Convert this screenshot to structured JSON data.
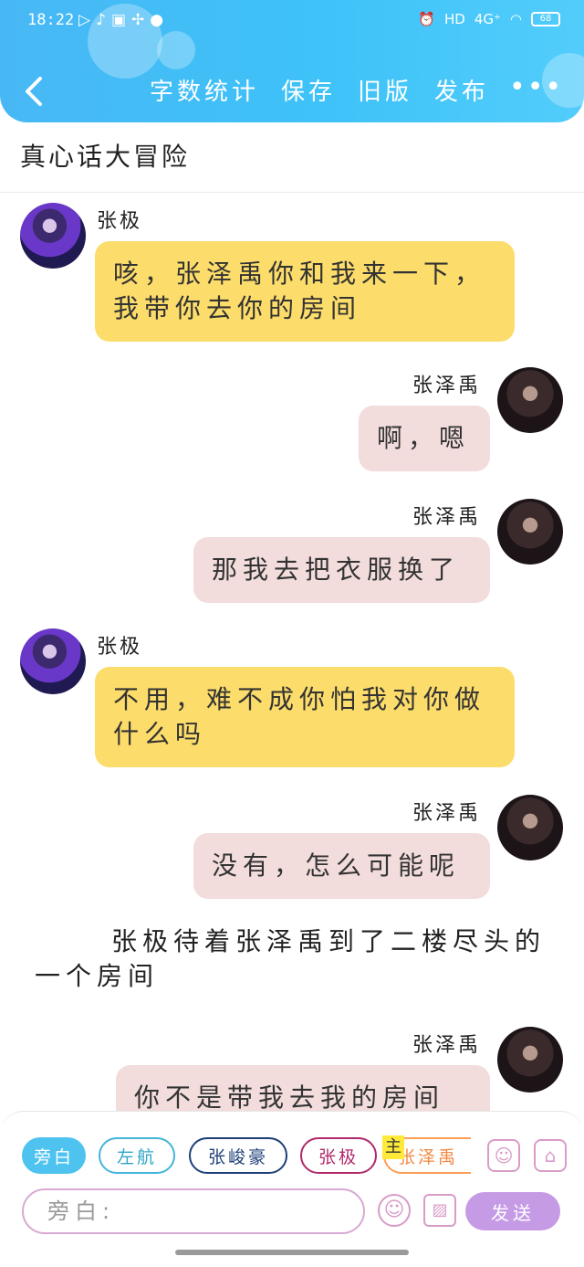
{
  "status_bar": {
    "time": "18:22",
    "network": "4G⁺",
    "hd": "HD",
    "battery": "68",
    "app_icons": [
      "play-icon",
      "tiktok-icon",
      "iqiyi-icon",
      "fan-icon",
      "qq-icon"
    ]
  },
  "toolbar": {
    "back_icon": "chevron-left-icon",
    "word_count": "字数统计",
    "save": "保存",
    "old_version": "旧版",
    "publish": "发布",
    "more": "•••"
  },
  "story_title": "真心话大冒险",
  "messages": [
    {
      "speaker": "张极",
      "side": "left",
      "text": "咳，张泽禹你和我来一下，我带你去你的房间"
    },
    {
      "speaker": "张泽禹",
      "side": "right",
      "text": "啊，嗯"
    },
    {
      "speaker": "张泽禹",
      "side": "right",
      "text": "那我去把衣服换了"
    },
    {
      "speaker": "张极",
      "side": "left",
      "text": "不用，难不成你怕我对你做什么吗"
    },
    {
      "speaker": "张泽禹",
      "side": "right",
      "text": "没有，怎么可能呢"
    },
    {
      "speaker": "张泽禹",
      "side": "right",
      "text": "你不是带我去我的房间"
    }
  ],
  "narration": "张极待着张泽禹到了二楼尽头的一个房间",
  "roles": {
    "narration": "旁白",
    "zuohang": "左航",
    "junhao": "张峻豪",
    "zhangji": "张极",
    "main_tag": "主",
    "zeyu": "张泽禹"
  },
  "input": {
    "placeholder": "旁白:"
  },
  "send_label": "发送",
  "colors": {
    "header": "#48b8f5",
    "left_bubble": "#fcdc6a",
    "right_bubble": "#f2dcdc",
    "send": "#c69be6"
  }
}
